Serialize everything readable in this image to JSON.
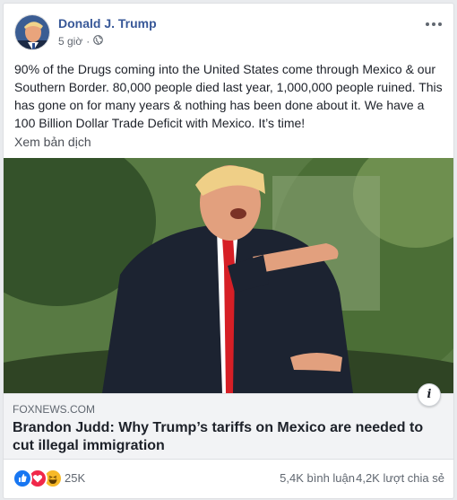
{
  "post": {
    "author": "Donald J. Trump",
    "time": "5 giờ",
    "privacy_icon": "globe-icon",
    "text": "90% of the Drugs coming into the United States come through Mexico & our Southern Border. 80,000 people died last year, 1,000,000 people ruined. This has gone on for many years & nothing has been done about it. We have a 100 Billion Dollar Trade Deficit with Mexico. It’s time!",
    "translate_label": "Xem bản dịch"
  },
  "link": {
    "domain": "FOXNEWS.COM",
    "title": "Brandon Judd: Why Trump’s tariffs on Mexico are needed to cut illegal immigration",
    "info_icon": "i"
  },
  "stats": {
    "reaction_icons": [
      "like-icon",
      "love-icon",
      "haha-icon"
    ],
    "reactions": "25K",
    "comments": "5,4K bình luận",
    "shares": "4,2K lượt chia sẻ"
  },
  "colors": {
    "author": "#385898",
    "like": "#1877f2",
    "love": "#f0284a",
    "haha": "#f7b928"
  }
}
